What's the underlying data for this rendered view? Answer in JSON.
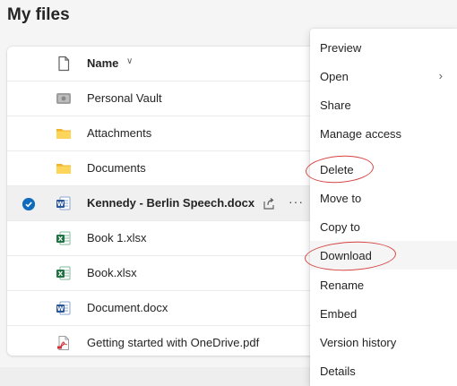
{
  "page": {
    "title": "My files"
  },
  "file_list": {
    "header": {
      "name_label": "Name",
      "sort_icon": "chevron-down-icon"
    },
    "rows": [
      {
        "name": "Personal Vault",
        "icon": "vault-icon",
        "selected": false
      },
      {
        "name": "Attachments",
        "icon": "folder-icon",
        "selected": false
      },
      {
        "name": "Documents",
        "icon": "folder-icon",
        "selected": false
      },
      {
        "name": "Kennedy - Berlin Speech.docx",
        "icon": "word-icon",
        "selected": true
      },
      {
        "name": "Book 1.xlsx",
        "icon": "excel-icon",
        "selected": false
      },
      {
        "name": "Book.xlsx",
        "icon": "excel-icon",
        "selected": false
      },
      {
        "name": "Document.docx",
        "icon": "word-icon",
        "selected": false
      },
      {
        "name": "Getting started with OneDrive.pdf",
        "icon": "pdf-icon",
        "selected": false
      }
    ]
  },
  "context_menu": {
    "items": [
      {
        "label": "Preview"
      },
      {
        "label": "Open",
        "has_submenu": true
      },
      {
        "label": "Share"
      },
      {
        "label": "Manage access"
      },
      {
        "label": "Delete",
        "highlighted_annotation": true
      },
      {
        "label": "Move to"
      },
      {
        "label": "Copy to"
      },
      {
        "label": "Download",
        "highlighted_annotation": true
      },
      {
        "label": "Rename"
      },
      {
        "label": "Embed"
      },
      {
        "label": "Version history"
      },
      {
        "label": "Details"
      }
    ]
  },
  "colors": {
    "accent": "#0f6cbd",
    "folder": "#f5c342",
    "word": "#2b579a",
    "excel": "#217346",
    "pdf": "#d13438",
    "annotation": "#d64545"
  }
}
